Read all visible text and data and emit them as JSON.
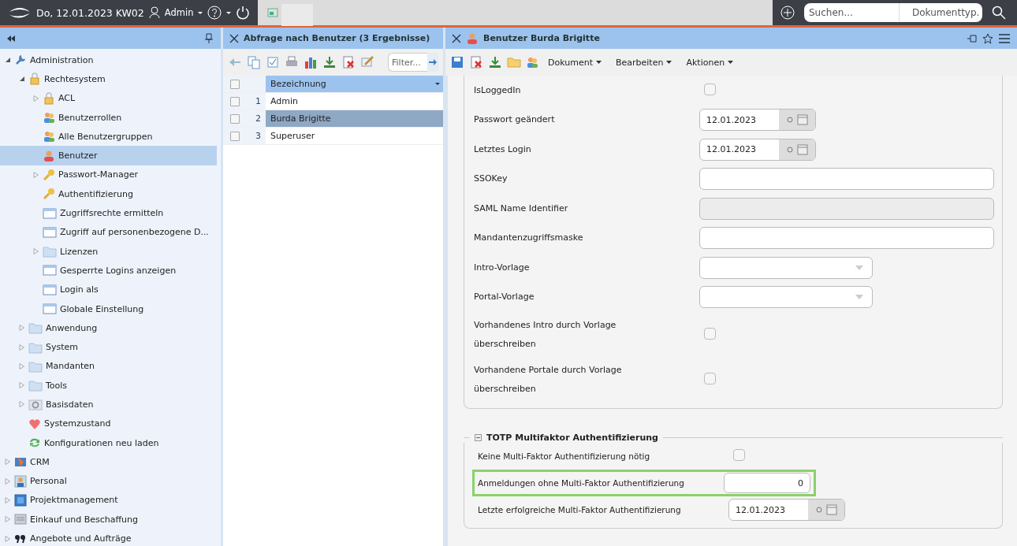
{
  "topbar": {
    "date": "Do, 12.01.2023 KW02",
    "user": "Admin",
    "search_placeholder": "Suchen...",
    "doctype": "Dokumenttyp."
  },
  "sidebar": {
    "items": [
      {
        "label": "Administration",
        "kind": "wrench",
        "expanded": true,
        "selected": false,
        "children": [
          {
            "label": "Rechtesystem",
            "kind": "lock",
            "expanded": true,
            "selected": false,
            "children": [
              {
                "label": "ACL",
                "kind": "lock",
                "expanded": false,
                "selected": false
              },
              {
                "label": "Benutzerrollen",
                "kind": "users",
                "selected": false
              },
              {
                "label": "Alle Benutzergruppen",
                "kind": "users",
                "selected": false
              },
              {
                "label": "Benutzer",
                "kind": "user",
                "selected": true
              },
              {
                "label": "Passwort-Manager",
                "kind": "key",
                "expanded": false,
                "selected": false
              },
              {
                "label": "Authentifizierung",
                "kind": "key",
                "selected": false
              },
              {
                "label": "Zugriffsrechte ermitteln",
                "kind": "window",
                "selected": false
              },
              {
                "label": "Zugriff auf personenbezogene D...",
                "kind": "window",
                "selected": false
              },
              {
                "label": "Lizenzen",
                "kind": "folder",
                "expanded": false,
                "selected": false
              },
              {
                "label": "Gesperrte Logins anzeigen",
                "kind": "window",
                "selected": false
              },
              {
                "label": "Login als",
                "kind": "window",
                "selected": false
              },
              {
                "label": "Globale Einstellung",
                "kind": "window",
                "selected": false
              }
            ]
          },
          {
            "label": "Anwendung",
            "kind": "folder",
            "expanded": false,
            "selected": false
          },
          {
            "label": "System",
            "kind": "folder",
            "expanded": false,
            "selected": false
          },
          {
            "label": "Mandanten",
            "kind": "folder",
            "expanded": false,
            "selected": false
          },
          {
            "label": "Tools",
            "kind": "folder",
            "expanded": false,
            "selected": false
          },
          {
            "label": "Basisdaten",
            "kind": "gear",
            "expanded": false,
            "selected": false
          },
          {
            "label": "Systemzustand",
            "kind": "heart",
            "selected": false
          },
          {
            "label": "Konfigurationen neu laden",
            "kind": "refresh",
            "selected": false
          }
        ]
      },
      {
        "label": "CRM",
        "kind": "crm",
        "expanded": false,
        "selected": false
      },
      {
        "label": "Personal",
        "kind": "person",
        "expanded": false,
        "selected": false
      },
      {
        "label": "Projektmanagement",
        "kind": "project",
        "expanded": false,
        "selected": false
      },
      {
        "label": "Einkauf und Beschaffung",
        "kind": "cart",
        "expanded": false,
        "selected": false
      },
      {
        "label": "Angebote und Aufträge",
        "kind": "quote",
        "expanded": false,
        "selected": false
      }
    ]
  },
  "list_panel": {
    "title": "Abfrage nach Benutzer (3 Ergebnisse)",
    "filter_placeholder": "Filter...",
    "column": "Bezeichnung",
    "all_checked": false,
    "rows": [
      {
        "number": "1",
        "name": "Admin",
        "checked": false,
        "selected": false
      },
      {
        "number": "2",
        "name": "Burda Brigitte",
        "checked": false,
        "selected": true
      },
      {
        "number": "3",
        "name": "Superuser",
        "checked": false,
        "selected": false
      }
    ]
  },
  "detail_panel": {
    "title": "Benutzer Burda Brigitte",
    "menus": [
      "Dokument",
      "Bearbeiten",
      "Aktionen"
    ],
    "fields": [
      {
        "label": "IsLoggedIn",
        "kind": "checkbox",
        "checked": false
      },
      {
        "label": "Passwort geändert",
        "kind": "date",
        "value": "12.01.2023"
      },
      {
        "label": "Letztes Login",
        "kind": "date",
        "value": "12.01.2023"
      },
      {
        "label": "SSOKey",
        "kind": "text",
        "disabled": false
      },
      {
        "label": "SAML Name Identifier",
        "kind": "text",
        "disabled": true
      },
      {
        "label": "Mandantenzugriffsmaske",
        "kind": "text",
        "disabled": false
      },
      {
        "label": "Intro-Vorlage",
        "kind": "select"
      },
      {
        "label": "Portal-Vorlage",
        "kind": "select"
      },
      {
        "label": "Vorhandenes Intro durch Vorlage überschreiben",
        "kind": "checkbox",
        "checked": false
      },
      {
        "label": "Vorhandene Portale durch Vorlage überschreiben",
        "kind": "checkbox",
        "checked": false
      }
    ],
    "mfa_section": {
      "title": "TOTP Multifaktor Authentifizierung",
      "expanded": true,
      "fields": [
        {
          "label": "Keine Multi-Faktor Authentifizierung nötig",
          "kind": "checkbox",
          "checked": false,
          "highlighted": false
        },
        {
          "label": "Anmeldungen ohne Multi-Faktor Authentifizierung",
          "kind": "number",
          "value": "0",
          "highlighted": true
        },
        {
          "label": "Letzte erfolgreiche Multi-Faktor Authentifizierung",
          "kind": "date",
          "value": "12.01.2023",
          "highlighted": false
        }
      ]
    }
  }
}
